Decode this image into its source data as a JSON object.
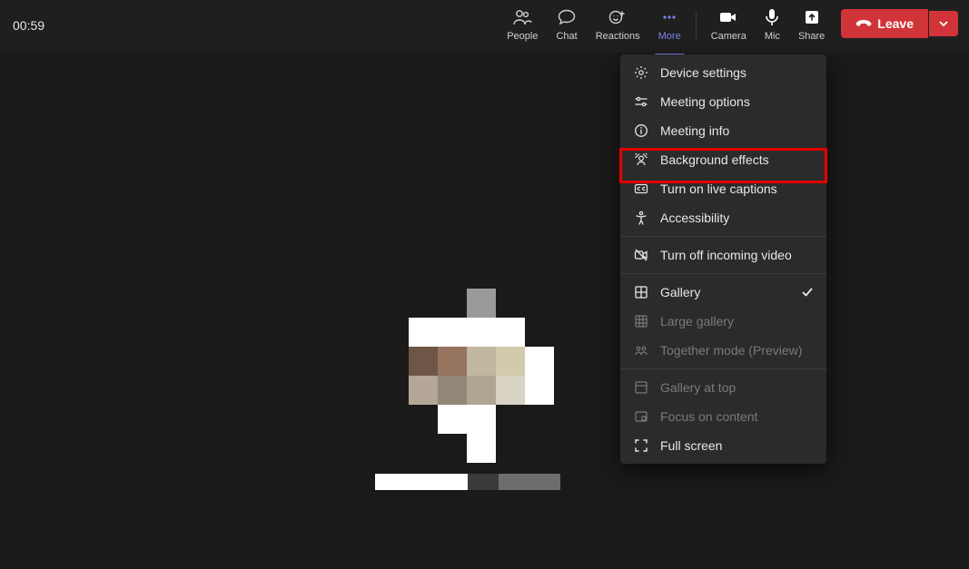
{
  "call": {
    "timer": "00:59"
  },
  "toolbar": {
    "people": "People",
    "chat": "Chat",
    "reactions": "Reactions",
    "more": "More",
    "camera": "Camera",
    "mic": "Mic",
    "share": "Share",
    "leave": "Leave"
  },
  "more_menu": {
    "device_settings": "Device settings",
    "meeting_options": "Meeting options",
    "meeting_info": "Meeting info",
    "background_effects": "Background effects",
    "live_captions": "Turn on live captions",
    "accessibility": "Accessibility",
    "turn_off_incoming": "Turn off incoming video",
    "gallery": "Gallery",
    "large_gallery": "Large gallery",
    "together_mode": "Together mode (Preview)",
    "gallery_top": "Gallery at top",
    "focus_content": "Focus on content",
    "full_screen": "Full screen"
  }
}
